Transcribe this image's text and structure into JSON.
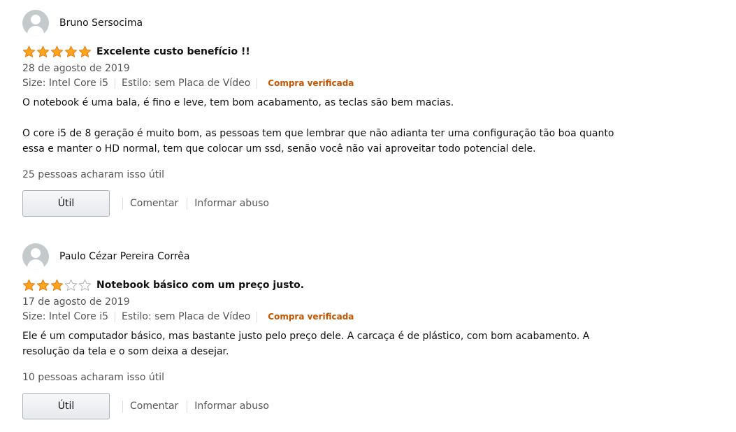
{
  "colors": {
    "star": "#FFA41C",
    "star_stroke": "#E47911",
    "verified": "#C45500"
  },
  "reviews": [
    {
      "author": "Bruno Sersocima",
      "rating": 5,
      "title": "Excelente custo benefício !!",
      "date": "28 de agosto de 2019",
      "size": "Size: Intel Core i5",
      "style": "Estilo: sem Placa de Vídeo",
      "verified": "Compra verificada",
      "body": "O notebook é uma bala, é fino e leve, tem bom acabamento, as teclas são bem macias.\n\nO core i5 de 8 geração é muito bom, as pessoas tem que lembrar que não adianta ter uma configuração tão boa quanto essa e manter o HD normal, tem que colocar um ssd, senão você não vai aproveitar todo potencial dele.",
      "helpful": "25 pessoas acharam isso útil",
      "helpful_button": "Útil",
      "comment": "Comentar",
      "report": "Informar abuso"
    },
    {
      "author": "Paulo Cézar Pereira Corrêa",
      "rating": 3,
      "title": "Notebook básico com um preço justo.",
      "date": "17 de agosto de 2019",
      "size": "Size: Intel Core i5",
      "style": "Estilo: sem Placa de Vídeo",
      "verified": "Compra verificada",
      "body": "Ele é um computador básico, mas bastante justo pelo preço dele. A carcaça é de plástico, com bom acabamento. A resolução da tela e o som deixa a desejar.",
      "helpful": "10 pessoas acharam isso útil",
      "helpful_button": "Útil",
      "comment": "Comentar",
      "report": "Informar abuso"
    }
  ]
}
